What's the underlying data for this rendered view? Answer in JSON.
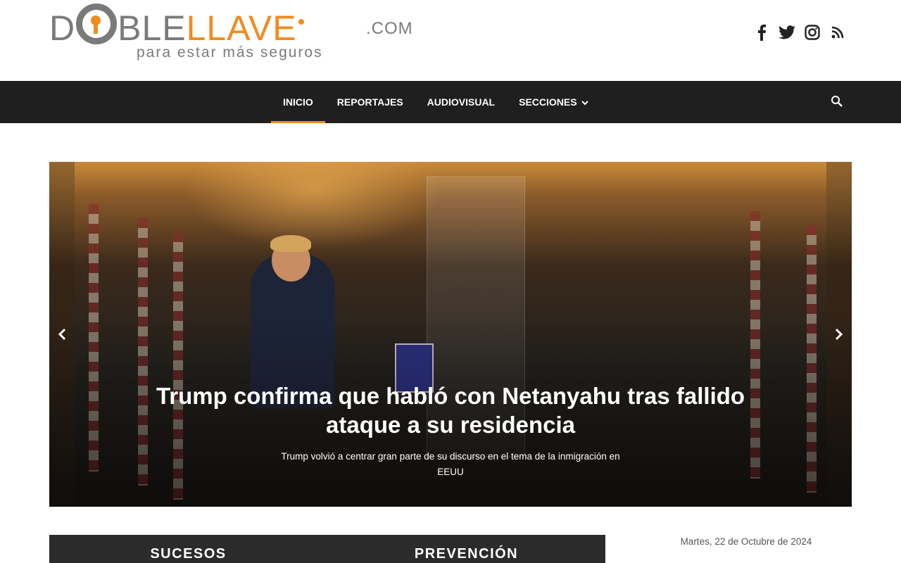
{
  "brand": {
    "logo_part1": "D",
    "logo_part2": "BLE",
    "logo_part3": "LLAVE",
    "logo_com": ".COM",
    "tagline": "para estar más seguros",
    "accent_color": "#f08c1e",
    "grey_color": "#7a7a7a"
  },
  "socials": [
    {
      "icon": "facebook-icon"
    },
    {
      "icon": "twitter-icon"
    },
    {
      "icon": "instagram-icon"
    },
    {
      "icon": "rss-icon"
    }
  ],
  "nav": {
    "items": [
      {
        "label": "INICIO",
        "active": true
      },
      {
        "label": "REPORTAJES",
        "active": false
      },
      {
        "label": "AUDIOVISUAL",
        "active": false
      },
      {
        "label": "SECCIONES",
        "active": false,
        "dropdown": true
      }
    ],
    "search_icon": "search-icon",
    "background": "#1f1f1f"
  },
  "hero": {
    "title": "Trump confirma que habló con Netanyahu tras fallido ataque a su residencia",
    "subtitle": "Trump volvió a centrar gran parte de su discurso en el tema de la inmigración en EEUU"
  },
  "sections": {
    "tabs": [
      "SUCESOS",
      "PREVENCIÓN"
    ]
  },
  "sidebar": {
    "date": "Martes, 22 de Octubre de 2024"
  }
}
